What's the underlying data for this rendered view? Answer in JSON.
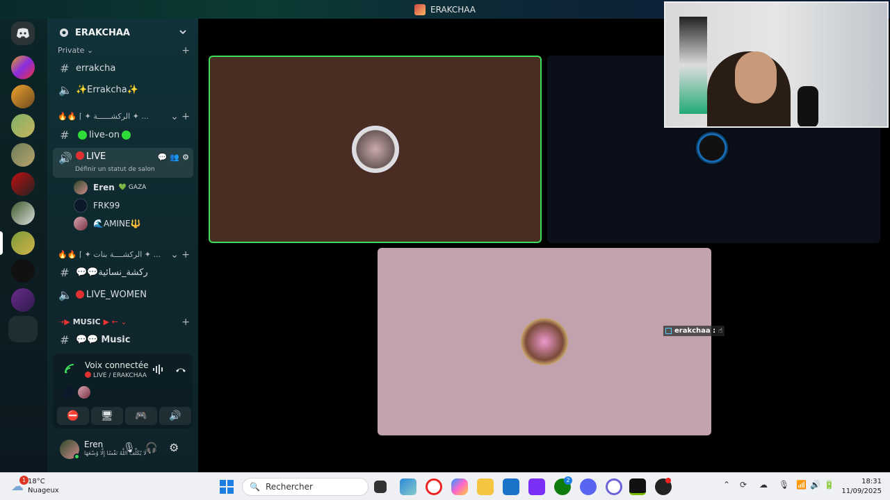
{
  "window": {
    "title": "ERAKCHAA"
  },
  "server": {
    "name": "ERAKCHAA",
    "categories": [
      {
        "label": "Private ⌄"
      },
      {
        "label": "🔥🔥 ⌈ ✦ الركشــــــة ✦ ..."
      },
      {
        "label": "🔥🔥 ⌈ ✦ الركشــــة بنات ✦ ..."
      },
      {
        "label": "MUSIC"
      }
    ],
    "channels": {
      "errakcha": "errakcha",
      "errakcha_voice": "✨Errakcha✨",
      "live_on": "live-on",
      "live": "LIVE",
      "live_status": "Définir un statut de salon",
      "women_text": "💬💬ركشة_نسائية",
      "live_women": "LIVE_WOMEN",
      "music": "Music"
    },
    "members": [
      {
        "name": "Eren",
        "tag": "💚 GAZA"
      },
      {
        "name": "FRK99",
        "tag": ""
      },
      {
        "name": "🌊AMINE🔱",
        "tag": ""
      }
    ]
  },
  "voice": {
    "status": "Voix connectée",
    "channel": "LIVE / ERAKCHAA"
  },
  "user": {
    "name": "Eren",
    "status": "لَا يُكَلِّفُ اللَّهُ نَفْسًا إِلَّا وُسْعَهَا •"
  },
  "overlay": {
    "name": "erakchaa :"
  },
  "taskbar": {
    "weather_temp": "18°C",
    "weather_desc": "Nuageux",
    "weather_badge": "1",
    "search_placeholder": "Rechercher",
    "time": "18:31",
    "date": "11/09/2025",
    "xbox_badge": "2"
  },
  "colors": {
    "accent_green": "#3ddc5a",
    "tile_brown": "#4a2d22",
    "tile_pink": "#c2a3ad",
    "live_red": "#e03131"
  }
}
